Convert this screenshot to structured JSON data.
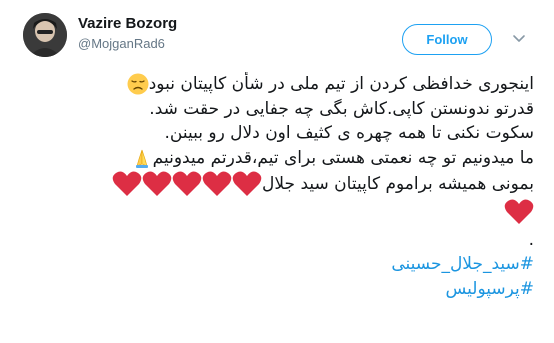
{
  "user": {
    "display_name": "Vazire Bozorg",
    "handle": "@MojganRad6"
  },
  "actions": {
    "follow_label": "Follow"
  },
  "tweet": {
    "line1": "اینجوری خدافظی کردن از تیم ملی در شأن کاپیتان نبود",
    "line2": "قدرتو ندونستن کاپی.کاش بگی چه جفایی در حقت شد.",
    "line3": "سکوت نکنی تا همه چهره ی کثیف اون دلال رو ببینن.",
    "line4a": "ما میدونیم تو چه نعمتی هستی برای تیم،قدرتم میدونیم",
    "line5": "بمونی همیشه براموم کاپیتان سید جلال",
    "dot": ".",
    "hashtag1": "#سید_جلال_حسینی",
    "hashtag2": "#پرسپولیس"
  },
  "icons": {
    "sad_face": "disappointed-face-emoji",
    "pray": "folded-hands-emoji",
    "heart": "red-heart-emoji",
    "chevron": "chevron-down-icon"
  },
  "colors": {
    "accent": "#1da1f2",
    "link": "#1b95e0",
    "secondary_text": "#657786",
    "heart": "#e0245e"
  }
}
